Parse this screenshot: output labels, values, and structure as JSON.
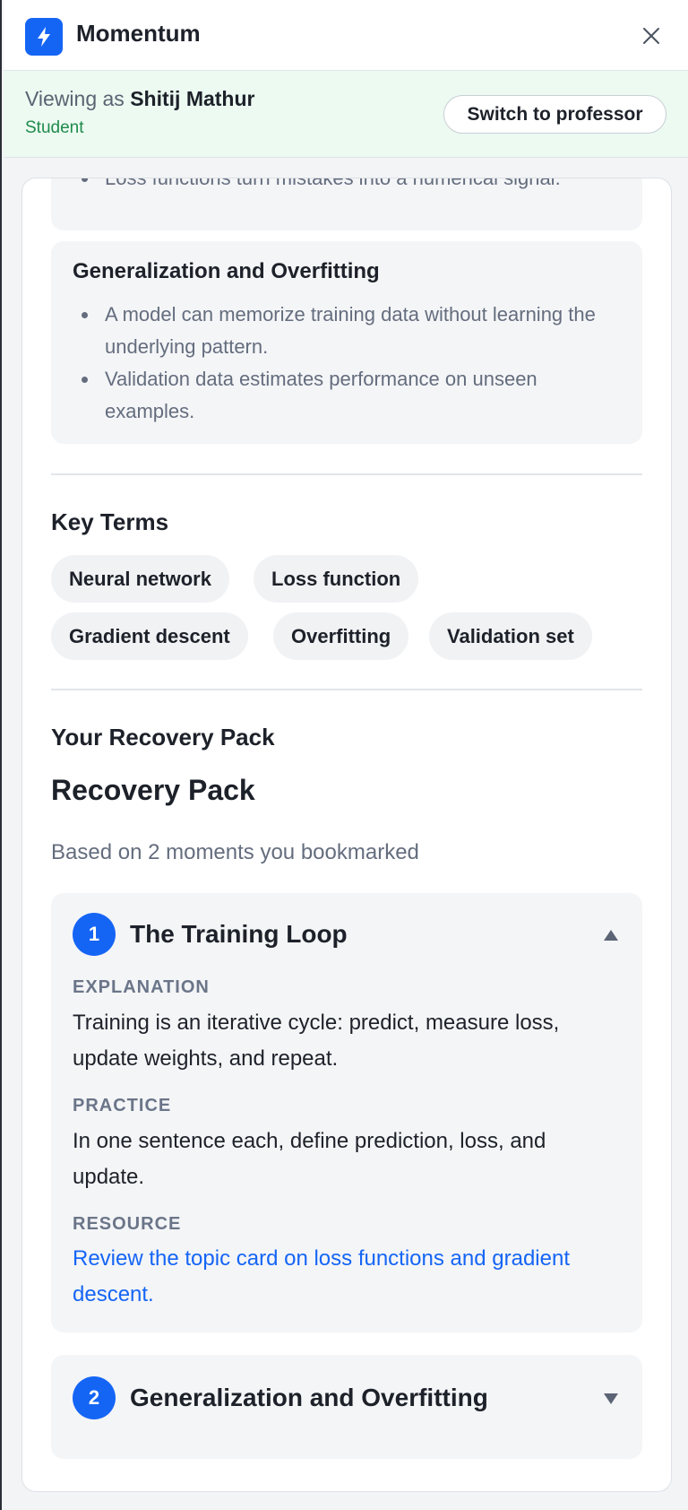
{
  "app": {
    "name": "Momentum"
  },
  "banner": {
    "viewing_prefix": "Viewing as",
    "user_name": "Shitij Mathur",
    "role": "Student",
    "switch_label": "Switch to professor"
  },
  "topics": [
    {
      "bullets": [
        "Loss functions turn mistakes into a numerical signal."
      ]
    },
    {
      "title": "Generalization and Overfitting",
      "bullets": [
        "A model can memorize training data without learning the underlying pattern.",
        "Validation data estimates performance on unseen examples."
      ]
    }
  ],
  "key_terms": {
    "heading": "Key Terms",
    "terms": [
      "Neural network",
      "Loss function",
      "Gradient descent",
      "Overfitting",
      "Validation set"
    ]
  },
  "recovery": {
    "section_heading": "Your Recovery Pack",
    "title": "Recovery Pack",
    "subtitle": "Based on 2 moments you bookmarked",
    "moments": [
      {
        "number": "1",
        "title": "The Training Loop",
        "expanded": true,
        "explanation_label": "EXPLANATION",
        "explanation": "Training is an iterative cycle: predict, measure loss, update weights, and repeat.",
        "practice_label": "PRACTICE",
        "practice": "In one sentence each, define prediction, loss, and update.",
        "resource_label": "RESOURCE",
        "resource": "Review the topic card on loss functions and gradient descent."
      },
      {
        "number": "2",
        "title": "Generalization and Overfitting",
        "expanded": false
      }
    ]
  },
  "icons": {
    "logo": "lightning-bolt-icon",
    "close": "close-icon",
    "collapse": "chevron-up-icon",
    "expand": "chevron-down-icon"
  },
  "colors": {
    "accent": "#1565f5",
    "banner_bg": "#ecfaf1",
    "role_text": "#1f8a4c"
  }
}
